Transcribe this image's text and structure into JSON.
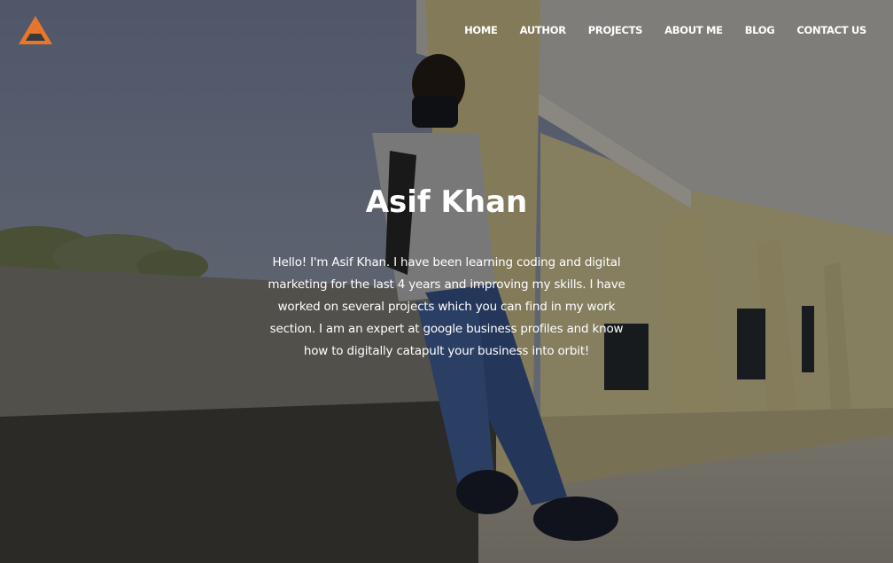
{
  "site": {
    "logo_icon": "triangle-logo-icon",
    "accent_color": "#e8762c"
  },
  "nav": {
    "items": [
      {
        "label": "HOME"
      },
      {
        "label": "AUTHOR"
      },
      {
        "label": "PROJECTS"
      },
      {
        "label": "ABOUT ME"
      },
      {
        "label": "BLOG"
      },
      {
        "label": "CONTACT US"
      }
    ]
  },
  "hero": {
    "title": "Asif Khan",
    "bio": "Hello! I'm Asif Khan. I have been learning coding and digital marketing for the last 4 years and improving my skills. I have worked on several projects which you can find in my work section. I am an expert at google business profiles and know how to digitally catapult your business into orbit!"
  }
}
